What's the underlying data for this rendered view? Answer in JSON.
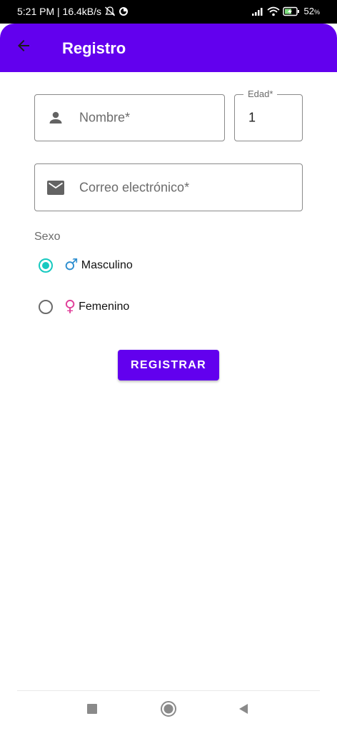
{
  "status_bar": {
    "time_speed": "5:21 PM | 16.4kB/s",
    "battery_pct": "52",
    "battery_unit": "%"
  },
  "app_bar": {
    "title": "Registro",
    "back_icon": "arrow-back-icon"
  },
  "form": {
    "name": {
      "placeholder": "Nombre*",
      "icon": "person-icon"
    },
    "age": {
      "label": "Edad*",
      "value": "1"
    },
    "email": {
      "placeholder": "Correo electrónico*",
      "icon": "mail-icon"
    },
    "sexo_label": "Sexo",
    "options": [
      {
        "label": "Masculino",
        "symbol": "♂",
        "color": "#2f8fd0",
        "checked": true
      },
      {
        "label": "Femenino",
        "symbol": "♀",
        "color": "#e0409a",
        "checked": false
      }
    ],
    "submit_label": "REGISTRAR"
  },
  "colors": {
    "primary": "#6200ee",
    "radio_accent": "#17c9c0"
  },
  "nav_bar": {
    "icons": [
      "recents-square-icon",
      "home-circle-icon",
      "back-triangle-icon"
    ]
  }
}
